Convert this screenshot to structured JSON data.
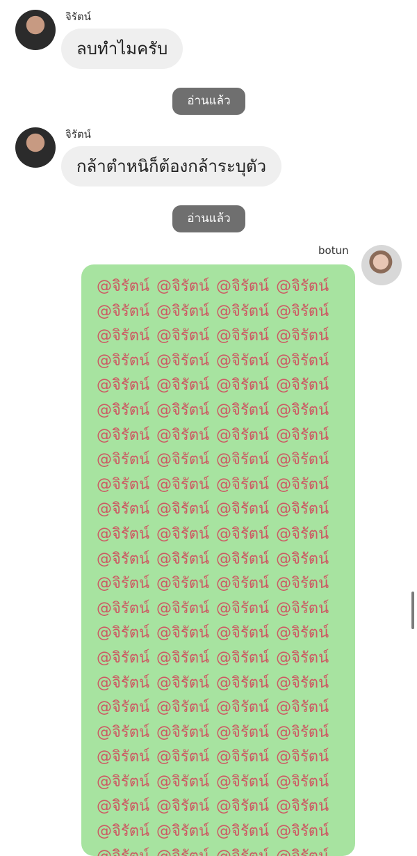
{
  "messages": [
    {
      "sender": "จิรัตน์",
      "text": "ลบทำไมครับ",
      "read_status": "อ่านแล้ว",
      "avatar_icon": "profile-avatar"
    },
    {
      "sender": "จิรัตน์",
      "text": "กล้าตำหนิก็ต้องกล้าระบุตัว",
      "read_status": "อ่านแล้ว",
      "avatar_icon": "profile-avatar"
    }
  ],
  "outgoing": {
    "sender": "botun",
    "mention": "@จิรัตน์",
    "avatar_icon": "profile-avatar"
  },
  "colors": {
    "incoming_bubble": "#efefef",
    "read_pill": "#6f6f6f",
    "outgoing_bubble": "#a7e3a0",
    "mention_text": "#cc5a63"
  }
}
